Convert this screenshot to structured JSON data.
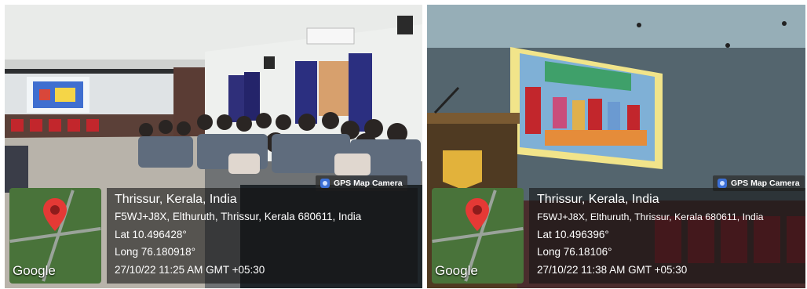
{
  "photos": [
    {
      "badge": "GPS Map Camera",
      "map_watermark": "Google",
      "place": "Thrissur, Kerala, India",
      "address": "F5WJ+J8X, Elthuruth, Thrissur, Kerala 680611, India",
      "lat": "Lat 10.496428°",
      "long": "Long 76.180918°",
      "datetime": "27/10/22 11:25 AM GMT +05:30"
    },
    {
      "badge": "GPS Map Camera",
      "map_watermark": "Google",
      "place": "Thrissur, Kerala, India",
      "address": "F5WJ+J8X, Elthuruth, Thrissur, Kerala 680611, India",
      "lat": "Lat 10.496396°",
      "long": "Long 76.18106°",
      "datetime": "27/10/22 11:38 AM GMT +05:30"
    }
  ],
  "colors": {
    "pin": "#e53935",
    "map_green": "#49733a",
    "screen_blue": "#3f6fd0"
  }
}
